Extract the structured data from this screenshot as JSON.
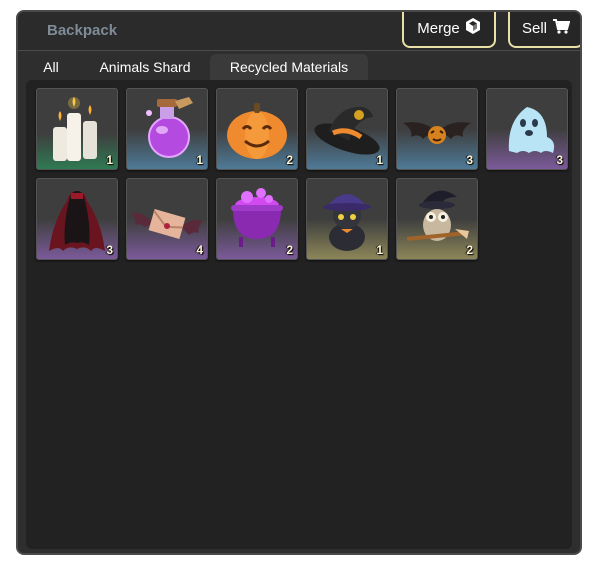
{
  "header": {
    "title": "Backpack",
    "merge_label": "Merge",
    "sell_label": "Sell"
  },
  "tabs": [
    {
      "label": "All",
      "active": false
    },
    {
      "label": "Animals Shard",
      "active": false
    },
    {
      "label": "Recycled Materials",
      "active": true
    }
  ],
  "items": [
    {
      "name": "candles",
      "icon": "candles-icon",
      "quantity": "1",
      "rarity": "green"
    },
    {
      "name": "potion",
      "icon": "potion-icon",
      "quantity": "1",
      "rarity": "blue"
    },
    {
      "name": "pumpkin",
      "icon": "pumpkin-icon",
      "quantity": "2",
      "rarity": "blue"
    },
    {
      "name": "witch hat",
      "icon": "witch-hat-icon",
      "quantity": "1",
      "rarity": "blue"
    },
    {
      "name": "bat",
      "icon": "bat-icon",
      "quantity": "3",
      "rarity": "blue"
    },
    {
      "name": "ghost",
      "icon": "ghost-icon",
      "quantity": "3",
      "rarity": "purple"
    },
    {
      "name": "cloak",
      "icon": "cloak-icon",
      "quantity": "3",
      "rarity": "purple"
    },
    {
      "name": "bat letter",
      "icon": "bat-letter-icon",
      "quantity": "4",
      "rarity": "purple"
    },
    {
      "name": "cauldron",
      "icon": "cauldron-icon",
      "quantity": "2",
      "rarity": "purple"
    },
    {
      "name": "black cat",
      "icon": "black-cat-icon",
      "quantity": "1",
      "rarity": "gold"
    },
    {
      "name": "owl witch",
      "icon": "owl-witch-icon",
      "quantity": "2",
      "rarity": "gold"
    }
  ],
  "colors": {
    "accent_border": "#e8e0a4",
    "panel_bg": "#2e2e2e",
    "title_color": "#7f8c98"
  }
}
